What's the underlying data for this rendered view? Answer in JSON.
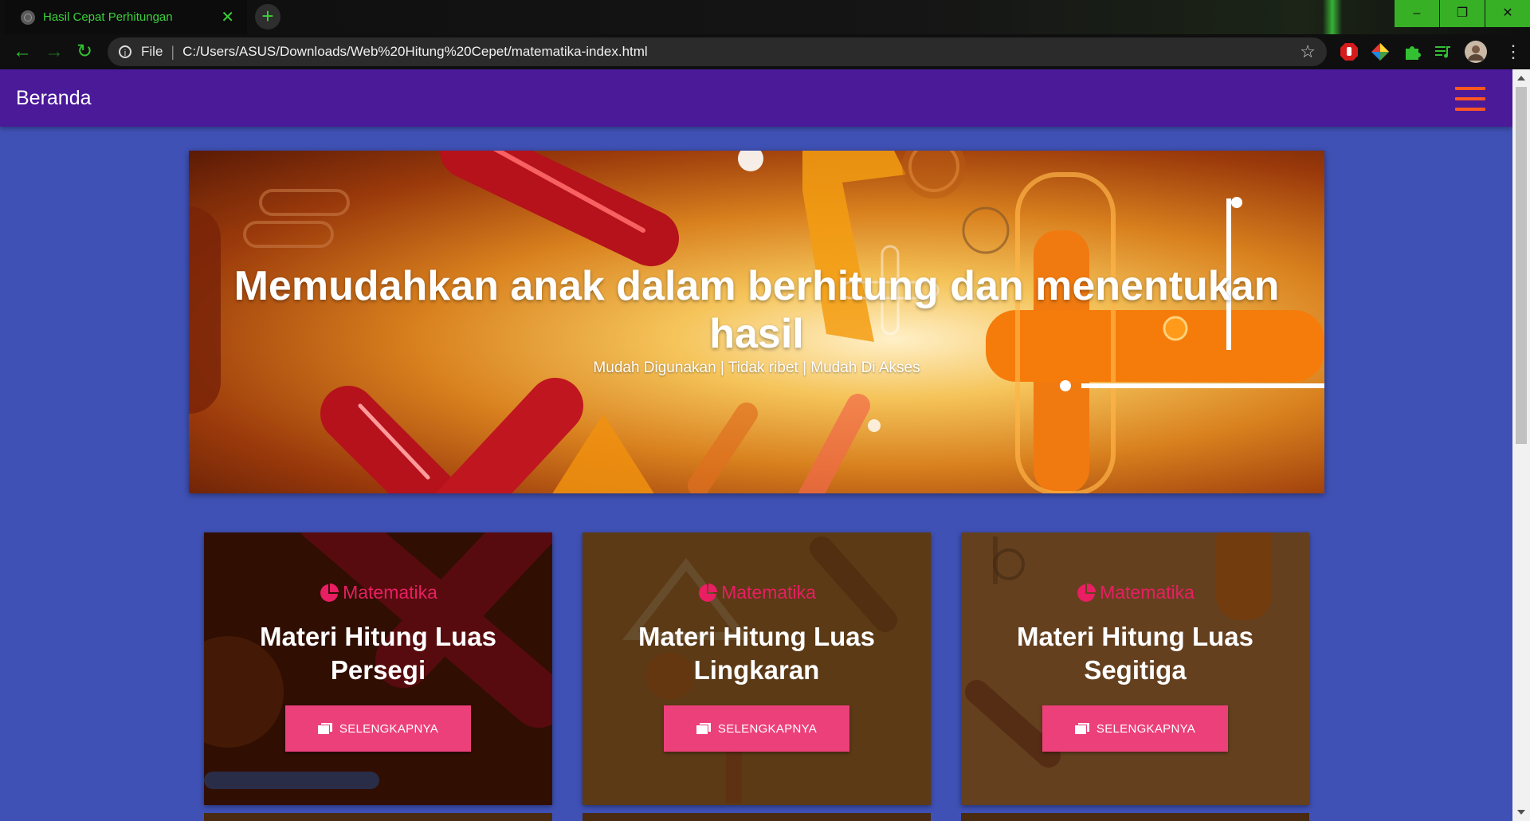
{
  "browser": {
    "tab_title": "Hasil Cepat Perhitungan",
    "tab_close": "✕",
    "new_tab": "+",
    "back": "←",
    "forward": "→",
    "reload": "↻",
    "url_scheme_label": "File",
    "url_separator": "|",
    "url": "C:/Users/ASUS/Downloads/Web%20Hitung%20Cepet/matematika-index.html",
    "bookmark_star": "☆",
    "window_controls": {
      "minimize": "–",
      "restore": "❐",
      "close": "✕"
    },
    "menu": "⋮"
  },
  "navbar": {
    "brand": "Beranda",
    "accent_color": "#ff5722",
    "background": "#4a1a99"
  },
  "hero": {
    "headline": "Memudahkan anak dalam berhitung dan menentukan hasil",
    "subtitle": "Mudah Digunakan | Tidak ribet | Mudah Di Akses"
  },
  "cards": [
    {
      "category": "Matematika",
      "title": "Materi Hitung Luas Persegi",
      "button": "SELENGKAPNYA"
    },
    {
      "category": "Matematika",
      "title": "Materi Hitung Luas Lingkaran",
      "button": "SELENGKAPNYA"
    },
    {
      "category": "Matematika",
      "title": "Materi Hitung Luas Segitiga",
      "button": "SELENGKAPNYA"
    }
  ],
  "colors": {
    "page_background": "#3f51b5",
    "category_text": "#e91e63",
    "button": "#ec407a"
  }
}
